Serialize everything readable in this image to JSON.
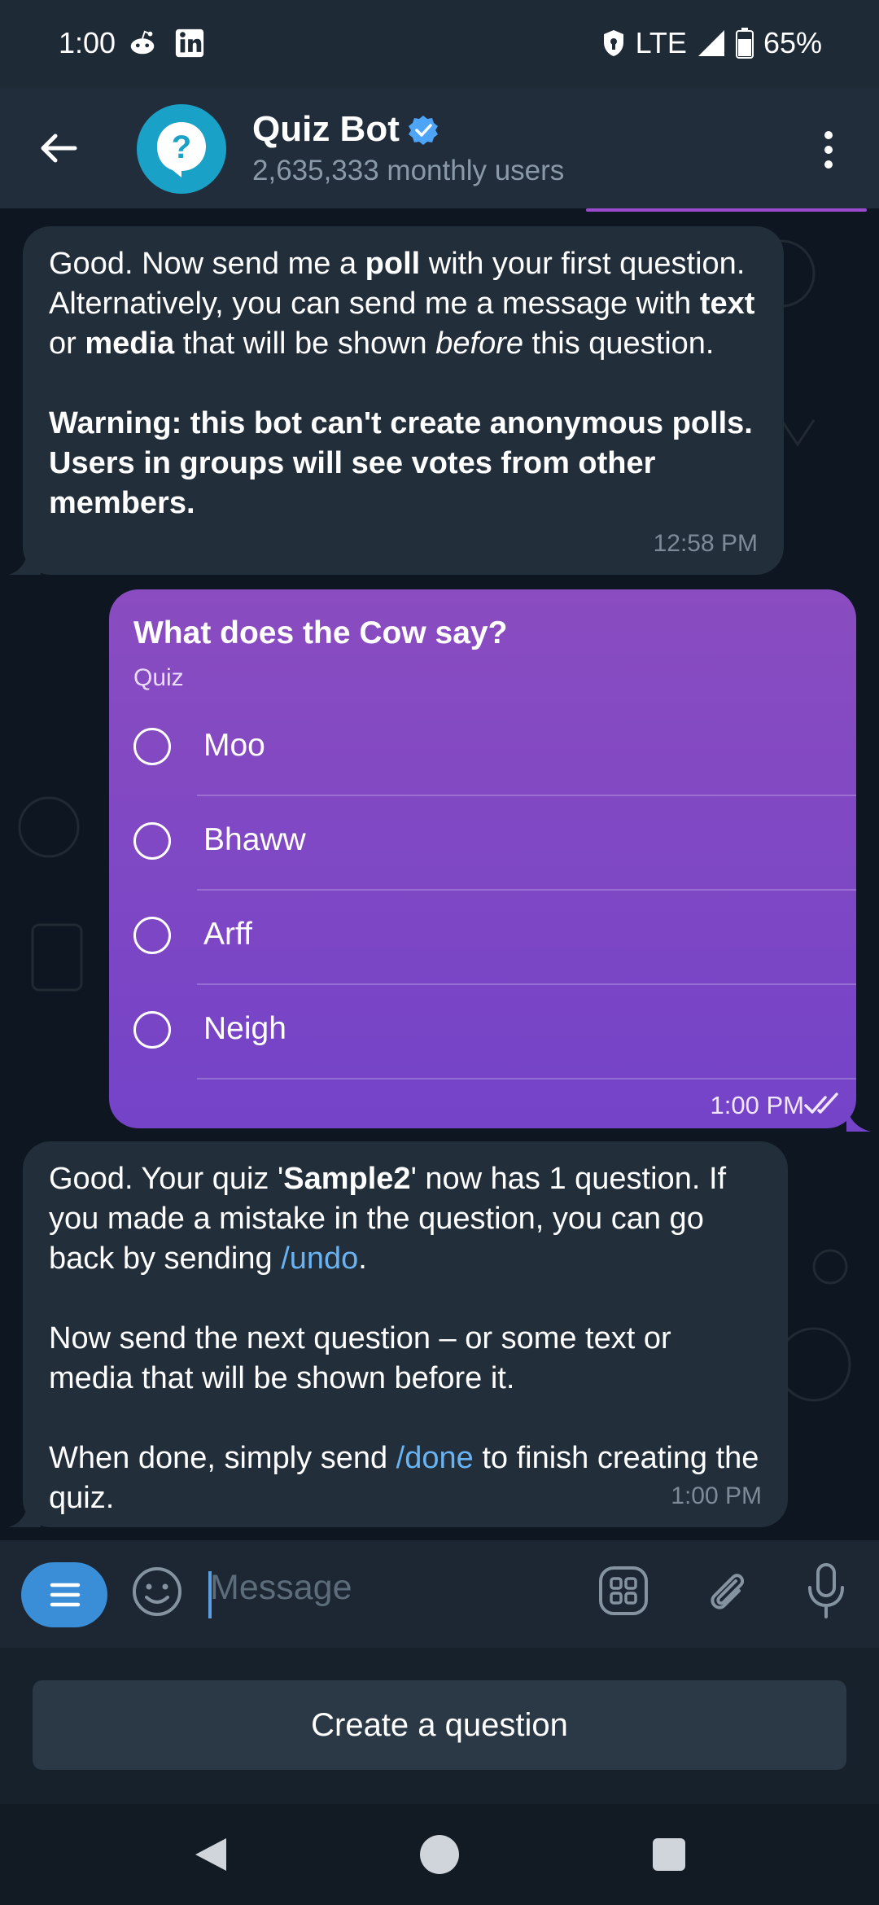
{
  "status_bar": {
    "time": "1:00",
    "network": "LTE",
    "battery": "65%",
    "icons": [
      "reddit-icon",
      "linkedin-icon",
      "vpn-shield-icon",
      "signal-icon",
      "battery-icon"
    ]
  },
  "header": {
    "title": "Quiz Bot",
    "subtitle": "2,635,333 monthly users",
    "verified": true
  },
  "messages": {
    "first": {
      "time": "12:58 PM",
      "p1_a": "Good. Now send me a ",
      "p1_b": "poll",
      "p1_c": " with your first question. Alternatively, you can send me a message with ",
      "p1_d": "text",
      "p1_e": " or ",
      "p1_f": "media",
      "p1_g": " that will be shown ",
      "p1_h": "before",
      "p1_i": " this question.",
      "warning": "Warning: this bot can't create anonymous polls. Users in groups will see votes from other members."
    },
    "poll": {
      "question": "What does the Cow say?",
      "type": "Quiz",
      "options": [
        "Moo",
        "Bhaww",
        "Arff",
        "Neigh"
      ],
      "time": "1:00 PM",
      "status": "read"
    },
    "second": {
      "time": "1:00 PM",
      "p1_a": "Good. Your quiz '",
      "p1_b": "Sample2",
      "p1_c": "' now has 1 question. If you made a mistake in the question, you can go back by sending ",
      "p1_link": "/undo",
      "p1_d": ".",
      "p2": "Now send the next question – or some text or media that will be shown before it.",
      "p3_a": "When done, simply send ",
      "p3_link": "/done",
      "p3_b": " to finish creating the quiz."
    }
  },
  "input": {
    "placeholder": "Message"
  },
  "keyboard": {
    "button": "Create a question"
  },
  "colors": {
    "accent": "#6ab3f3",
    "poll_top": "#8a4cc0",
    "poll_bottom": "#7443c8",
    "bubble_in": "#222e3a",
    "chat_bg": "#0e1621"
  }
}
